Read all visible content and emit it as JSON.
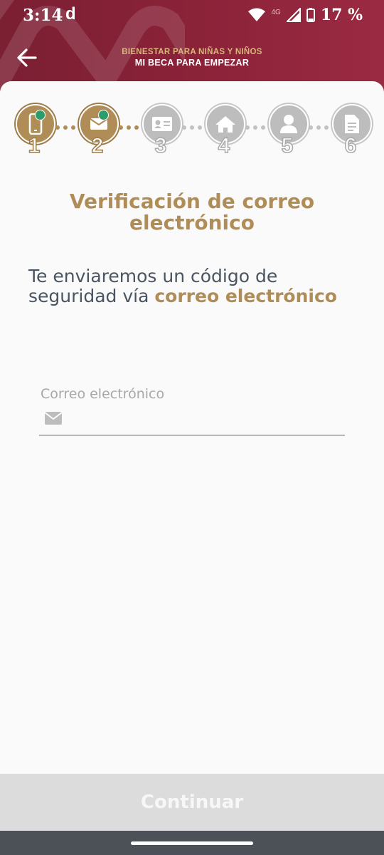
{
  "status_bar": {
    "time": "3:14",
    "app_indicator": "d",
    "network": "4G",
    "battery": "17 %"
  },
  "header": {
    "subtitle": "BIENESTAR PARA NIÑAS Y NIÑOS",
    "title": "MI BECA PARA EMPEZAR"
  },
  "steps": [
    {
      "number": "1",
      "icon": "phone-icon",
      "state": "done"
    },
    {
      "number": "2",
      "icon": "envelope-icon",
      "state": "done"
    },
    {
      "number": "3",
      "icon": "id-card-icon",
      "state": "todo"
    },
    {
      "number": "4",
      "icon": "home-icon",
      "state": "todo"
    },
    {
      "number": "5",
      "icon": "user-icon",
      "state": "todo"
    },
    {
      "number": "6",
      "icon": "document-icon",
      "state": "todo"
    }
  ],
  "main": {
    "title": "Verificación de correo electrónico",
    "description_prefix": "Te enviaremos un código de seguridad vía ",
    "description_highlight": "correo electrónico"
  },
  "email_field": {
    "label": "Correo electrónico",
    "value": ""
  },
  "continue_button": {
    "label": "Continuar",
    "enabled": false
  },
  "colors": {
    "header": "#8a2238",
    "accent_gold": "#b08d57",
    "text_dark": "#4a5561"
  }
}
